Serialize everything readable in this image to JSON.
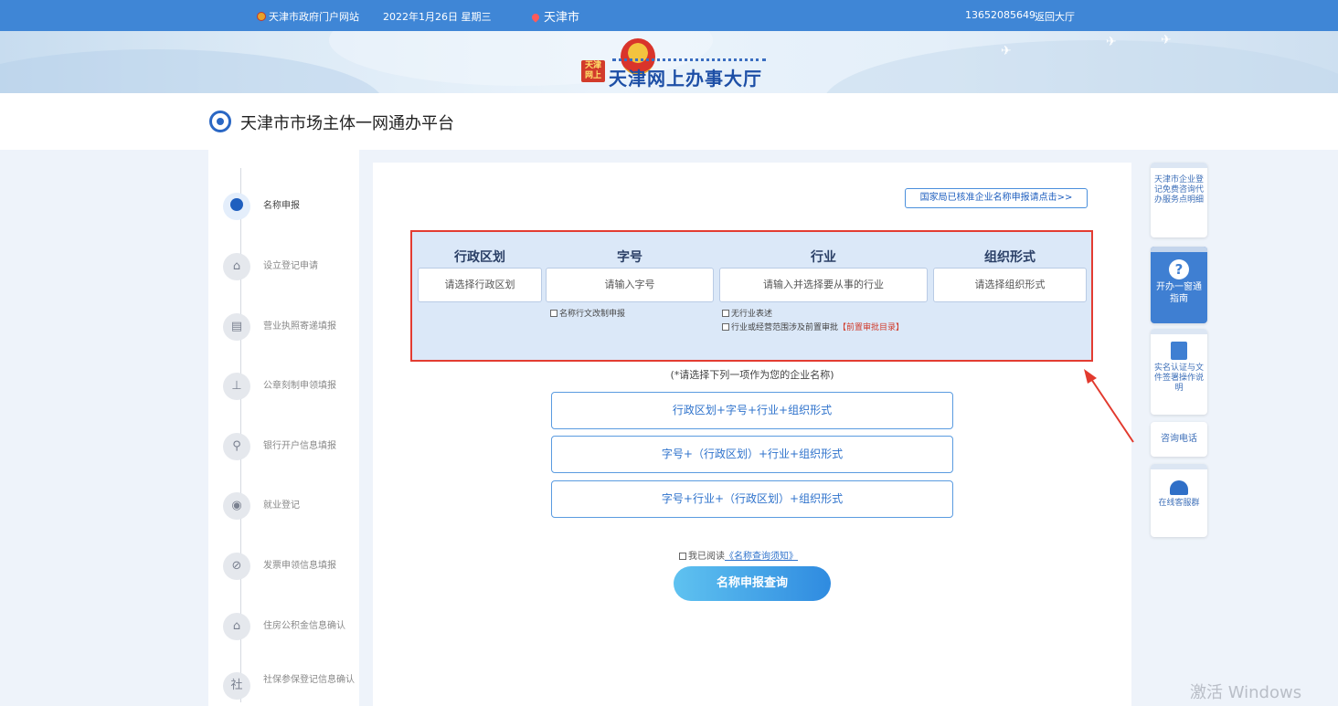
{
  "topbar": {
    "portal": "天津市政府门户网站",
    "date": "2022年1月26日 星期三",
    "city": "天津市",
    "phone": "13652085649",
    "back": "返回大厅"
  },
  "banner": {
    "badge": "天津网上",
    "title": "天津网上办事大厅"
  },
  "platform": {
    "title": "天津市市场主体一网通办平台"
  },
  "steps": [
    {
      "label": "名称申报"
    },
    {
      "label": "设立登记申请"
    },
    {
      "label": "营业执照寄递填报"
    },
    {
      "label": "公章刻制申领填报"
    },
    {
      "label": "银行开户信息填报"
    },
    {
      "label": "就业登记"
    },
    {
      "label": "发票申领信息填报"
    },
    {
      "label": "住房公积金信息确认"
    },
    {
      "label": "社保参保登记信息确认"
    }
  ],
  "main": {
    "national_link": "国家局已核准企业名称申报请点击>>",
    "columns": {
      "region": {
        "header": "行政区划",
        "placeholder": "请选择行政区划"
      },
      "brand": {
        "header": "字号",
        "placeholder": "请输入字号"
      },
      "industry": {
        "header": "行业",
        "placeholder": "请输入并选择要从事的行业"
      },
      "org": {
        "header": "组织形式",
        "placeholder": "请选择组织形式"
      }
    },
    "checks": {
      "admin_name": "名称行文改制申报",
      "no_industry": "无行业表述",
      "prereq": "行业或经营范围涉及前置审批",
      "prereq_link": "【前置审批目录】"
    },
    "hint": "(*请选择下列一项作为您的企业名称)",
    "options": [
      "行政区划+字号+行业+组织形式",
      "字号+（行政区划）+行业+组织形式",
      "字号+行业+（行政区划）+组织形式"
    ],
    "agree_prefix": "我已阅读",
    "agree_link": "《名称查询须知》",
    "query_button": "名称申报查询"
  },
  "right": {
    "consult_card": "天津市企业登记免费咨询代办服务点明细",
    "guide": "开办一窗通指南",
    "realname": "实名认证与文件签署操作说明",
    "hotline": "咨询电话",
    "service": "在线客服群"
  },
  "watermark": "激活 Windows"
}
